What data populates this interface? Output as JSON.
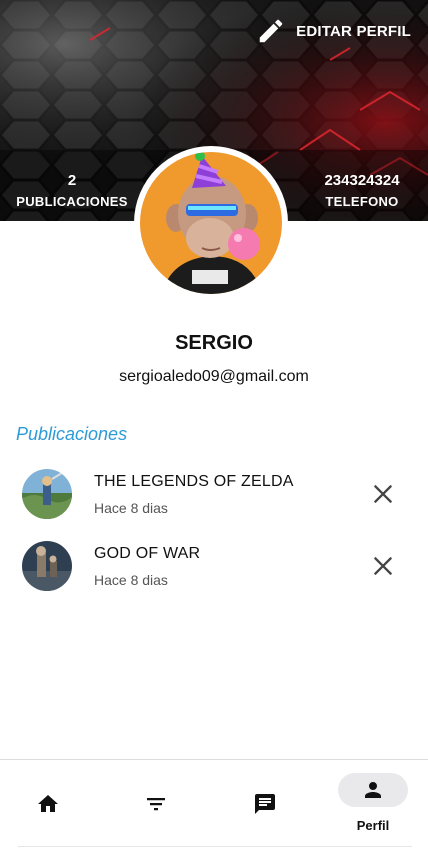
{
  "header": {
    "edit_label": "EDITAR PERFIL",
    "publications_count": "2",
    "publications_label": "PUBLICACIONES",
    "phone_value": "234324324",
    "phone_label": "TELEFONO"
  },
  "profile": {
    "name": "SERGIO",
    "email": "sergioaledo09@gmail.com"
  },
  "section_title": "Publicaciones",
  "posts": [
    {
      "title": "THE LEGENDS OF ZELDA",
      "time": "Hace 8 dias",
      "thumb_icon": "zelda-thumbnail"
    },
    {
      "title": "GOD OF WAR",
      "time": "Hace 8 dias",
      "thumb_icon": "god-of-war-thumbnail"
    }
  ],
  "nav": {
    "items": [
      {
        "icon": "home-icon"
      },
      {
        "icon": "filter-icon"
      },
      {
        "icon": "chat-icon"
      },
      {
        "icon": "person-icon",
        "label": "Perfil",
        "active": true
      }
    ]
  },
  "colors": {
    "accent": "#2d9bd6",
    "cover_dark": "#151515",
    "cover_glow": "#d0202a",
    "nav_active_bg": "#e9e9ec"
  }
}
